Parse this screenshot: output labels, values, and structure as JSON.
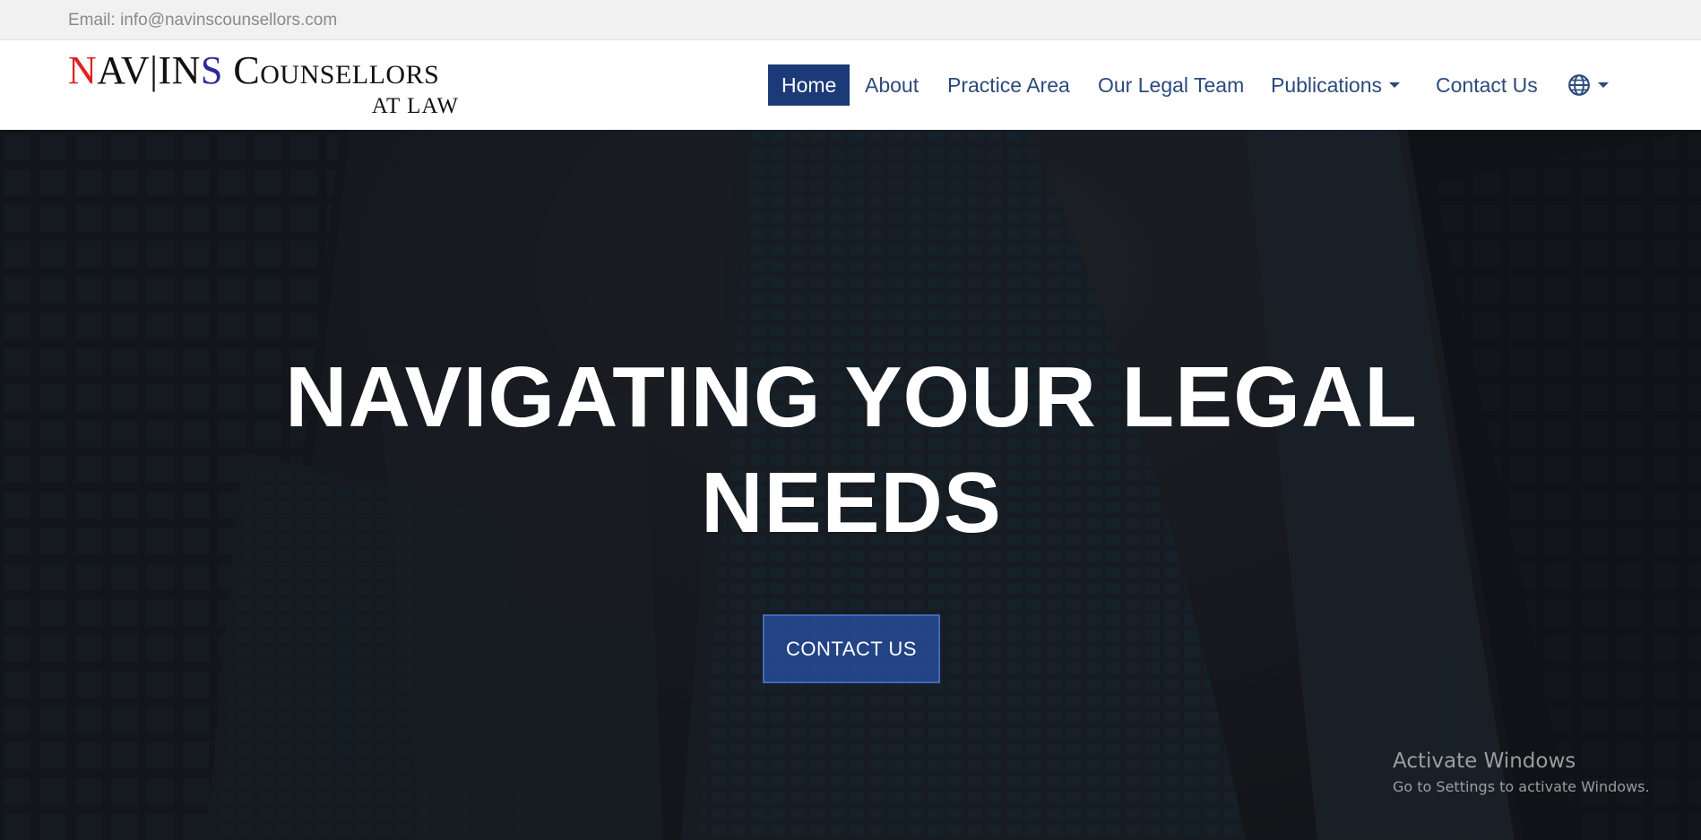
{
  "topbar": {
    "email": "Email: info@navinscounsellors.com"
  },
  "logo": {
    "n": "N",
    "av": "AV",
    "sep": "|",
    "in": "IN",
    "s": "S",
    "c": "C",
    "ounsellors": "OUNSELLORS",
    "at_law": "AT LAW"
  },
  "nav": {
    "items": [
      {
        "label": "Home",
        "active": true
      },
      {
        "label": "About"
      },
      {
        "label": "Practice Area"
      },
      {
        "label": "Our Legal Team"
      },
      {
        "label": "Publications",
        "has_dropdown": true
      },
      {
        "label": "Contact Us"
      }
    ],
    "language_icon": "globe-icon"
  },
  "hero": {
    "title_line1": "NAVIGATING YOUR LEGAL",
    "title_line2": "NEEDS",
    "cta_label": "CONTACT US"
  },
  "watermark": {
    "title": "Activate Windows",
    "subtitle": "Go to Settings to activate Windows."
  },
  "colors": {
    "nav_active_bg": "#1c3a78",
    "nav_text": "#2c4a7c",
    "cta_bg": "#284ea0",
    "logo_red": "#e0211d",
    "logo_blue": "#2a2a9a"
  }
}
